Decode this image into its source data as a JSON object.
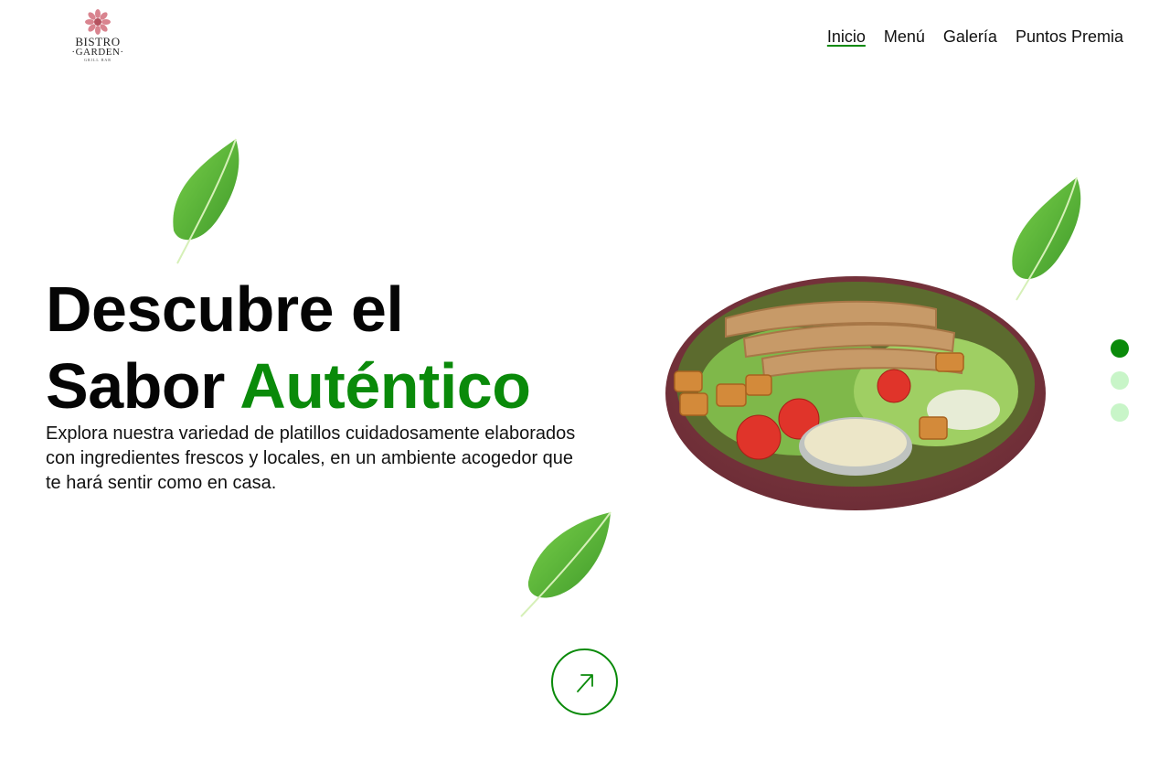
{
  "brand": {
    "name_line1": "BISTRO",
    "name_line2": "·GARDEN·",
    "tagline": "GRILL BAR",
    "logo_icon": "flower-icon"
  },
  "nav": {
    "items": [
      {
        "label": "Inicio",
        "active": true
      },
      {
        "label": "Menú",
        "active": false
      },
      {
        "label": "Galería",
        "active": false
      },
      {
        "label": "Puntos Premia",
        "active": false
      }
    ]
  },
  "hero": {
    "title_line1": "Descubre el",
    "title_line2_plain": "Sabor ",
    "title_line2_accent": "Auténtico",
    "description": "Explora nuestra variedad de platillos cuidadosamente elaborados con ingredientes frescos y locales, en un ambiente acogedor que te hará sentir como en casa."
  },
  "slider": {
    "total": 3,
    "active_index": 0
  },
  "cta": {
    "icon": "arrow-up-right-icon"
  },
  "colors": {
    "accent": "#0a8a0a",
    "dot_inactive": "#c8f5c8",
    "text": "#111111",
    "background": "#ffffff"
  }
}
